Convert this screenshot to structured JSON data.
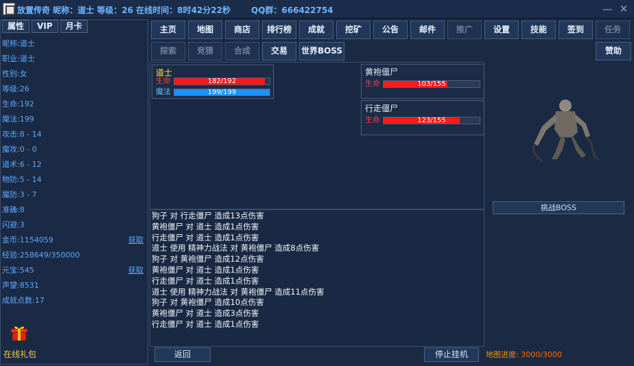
{
  "titlebar": {
    "title": "放置传奇 昵称：道士 等级：26 在线时间：8时42分22秒",
    "qq": "QQ群：666422754",
    "minimize": "—",
    "close": "✕"
  },
  "left": {
    "tabs": [
      {
        "label": "属性"
      },
      {
        "label": "VIP"
      },
      {
        "label": "月卡"
      }
    ],
    "stats": [
      {
        "label": "昵称:",
        "value": "道士"
      },
      {
        "label": "职业:",
        "value": "道士"
      },
      {
        "label": "性别:",
        "value": "女"
      },
      {
        "label": "等级:",
        "value": "26"
      },
      {
        "label": "生命:",
        "value": "192"
      },
      {
        "label": "魔法:",
        "value": "199"
      },
      {
        "label": "攻击:",
        "value": "8 - 14"
      },
      {
        "label": "魔攻:",
        "value": "0 - 0"
      },
      {
        "label": "道术:",
        "value": "6 - 12"
      },
      {
        "label": "物防:",
        "value": "5 - 14"
      },
      {
        "label": "魔防:",
        "value": "3 - 7"
      },
      {
        "label": "准确:",
        "value": "8"
      },
      {
        "label": "闪避:",
        "value": "3"
      },
      {
        "label": "金币:",
        "value": "1154059"
      },
      {
        "label": "经验:",
        "value": "258649/350000"
      },
      {
        "label": "元宝:",
        "value": "545"
      },
      {
        "label": "声望:",
        "value": "8531"
      },
      {
        "label": "成就点数:",
        "value": "17"
      }
    ],
    "claim_gold": "获取",
    "claim_ingot": "获取",
    "gift_label": "在线礼包"
  },
  "nav": {
    "row1": [
      {
        "label": "主页",
        "enabled": true
      },
      {
        "label": "地图",
        "enabled": true
      },
      {
        "label": "商店",
        "enabled": true
      },
      {
        "label": "排行榜",
        "enabled": true
      },
      {
        "label": "成就",
        "enabled": true
      },
      {
        "label": "挖矿",
        "enabled": true
      },
      {
        "label": "公告",
        "enabled": true
      },
      {
        "label": "邮件",
        "enabled": true
      },
      {
        "label": "推广",
        "enabled": false
      },
      {
        "label": "设置",
        "enabled": true
      },
      {
        "label": "技能",
        "enabled": true
      },
      {
        "label": "签到",
        "enabled": true
      },
      {
        "label": "任务",
        "enabled": false
      }
    ],
    "row2": [
      {
        "label": "探索",
        "enabled": false
      },
      {
        "label": "竞猜",
        "enabled": false
      },
      {
        "label": "合成",
        "enabled": false
      },
      {
        "label": "交易",
        "enabled": true
      },
      {
        "label": "世界BOSS",
        "enabled": true
      }
    ],
    "sponsor": "赞助"
  },
  "battle": {
    "player": {
      "name": "道士",
      "hp_label": "生命",
      "hp": 182,
      "hp_max": 192,
      "hp_text": "182/192",
      "mp_label": "魔法",
      "mp": 199,
      "mp_max": 199,
      "mp_text": "199/199"
    },
    "enemies": [
      {
        "name": "黄袍僵尸",
        "hp_label": "生命",
        "hp": 103,
        "hp_max": 155,
        "hp_text": "103/155"
      },
      {
        "name": "行走僵尸",
        "hp_label": "生命",
        "hp": 123,
        "hp_max": 155,
        "hp_text": "123/155"
      }
    ]
  },
  "right": {
    "boss_button": "挑战BOSS",
    "progress_label": "地图进度:",
    "progress_value": "3000/3000"
  },
  "log": {
    "lines": [
      "狗子 对 行走僵尸 造成13点伤害",
      "黄袍僵尸 对 道士 造成1点伤害",
      "行走僵尸 对 道士 造成1点伤害",
      "道士 使用 精神力战法 对 黄袍僵尸 造成8点伤害",
      "狗子 对 黄袍僵尸 造成12点伤害",
      "黄袍僵尸 对 道士 造成1点伤害",
      "行走僵尸 对 道士 造成1点伤害",
      "道士 使用 精神力战法 对 黄袍僵尸 造成11点伤害",
      "狗子 对 黄袍僵尸 造成10点伤害",
      "黄袍僵尸 对 道士 造成3点伤害",
      "行走僵尸 对 道士 造成1点伤害"
    ],
    "back_button": "返回",
    "stop_button": "停止挂机"
  }
}
